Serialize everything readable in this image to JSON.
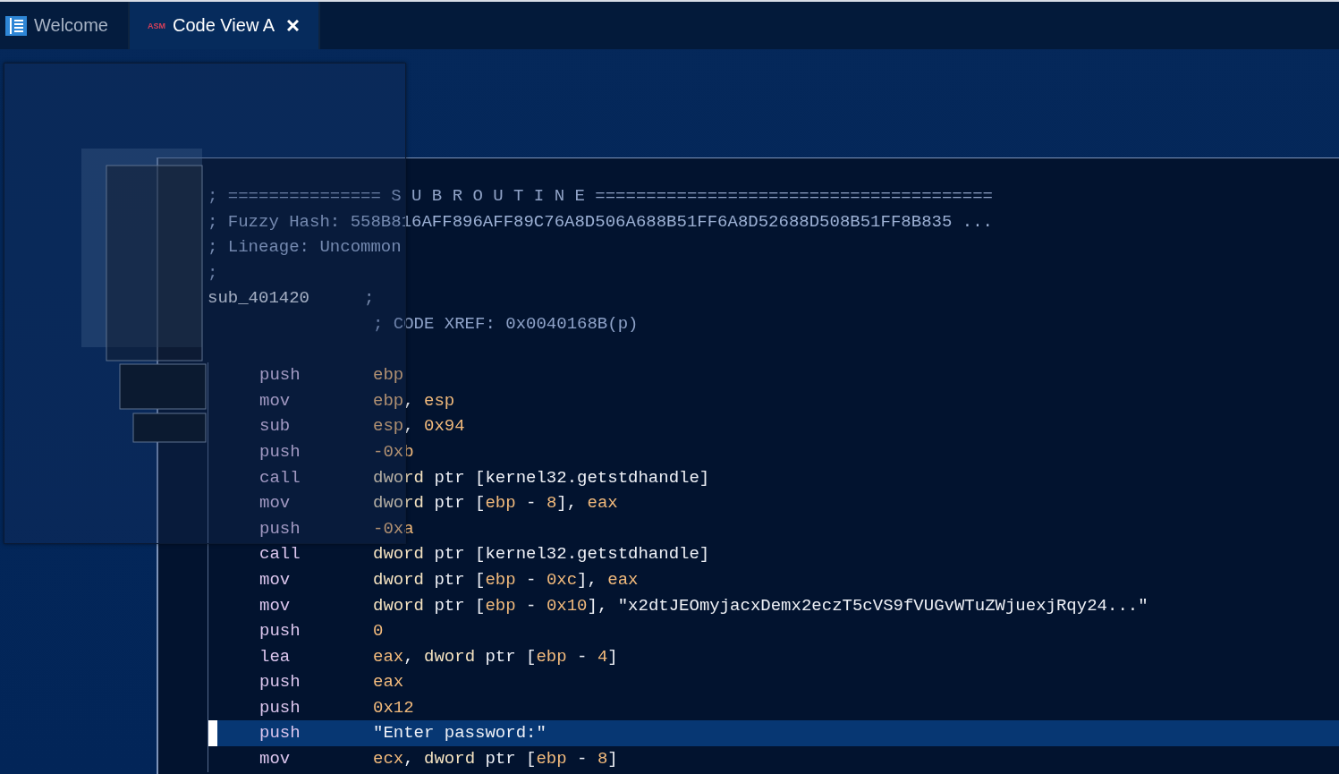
{
  "tabs": [
    {
      "label": "Welcome",
      "selected": false,
      "closable": false
    },
    {
      "label": "Code View A",
      "badge": "ASM",
      "selected": true,
      "closable": true
    }
  ],
  "block": {
    "header_lines": [
      "; =============== S U B R O U T I N E =======================================",
      "; Fuzzy Hash: 558B816AFF896AFF89C76A8D506A688B51FF6A8D52688D508B51FF8B835 ...",
      "; Lineage: Uncommon",
      ";"
    ],
    "label": {
      "name": "sub_401420",
      "comment": ";"
    },
    "xref": "; CODE XREF: 0x0040168B(p)",
    "instructions": [
      {
        "mnemonic": "push",
        "selected": false,
        "operands": [
          {
            "text": "ebp",
            "kind": "reg"
          }
        ]
      },
      {
        "mnemonic": "mov",
        "selected": false,
        "operands": [
          {
            "text": "ebp",
            "kind": "reg"
          },
          {
            "text": ", ",
            "kind": "plain"
          },
          {
            "text": "esp",
            "kind": "reg"
          }
        ]
      },
      {
        "mnemonic": "sub",
        "selected": false,
        "operands": [
          {
            "text": "esp",
            "kind": "reg"
          },
          {
            "text": ", ",
            "kind": "plain"
          },
          {
            "text": "0x94",
            "kind": "reg"
          }
        ]
      },
      {
        "mnemonic": "push",
        "selected": false,
        "operands": [
          {
            "text": "-0xb",
            "kind": "reg"
          }
        ]
      },
      {
        "mnemonic": "call",
        "selected": false,
        "operands": [
          {
            "text": "dword",
            "kind": "kw"
          },
          {
            "text": " ptr [kernel32.getstdhandle]",
            "kind": "plain"
          }
        ]
      },
      {
        "mnemonic": "mov",
        "selected": false,
        "operands": [
          {
            "text": "dword",
            "kind": "kw"
          },
          {
            "text": " ptr [",
            "kind": "plain"
          },
          {
            "text": "ebp",
            "kind": "reg"
          },
          {
            "text": " - ",
            "kind": "plain"
          },
          {
            "text": "8",
            "kind": "reg"
          },
          {
            "text": "], ",
            "kind": "plain"
          },
          {
            "text": "eax",
            "kind": "reg"
          }
        ]
      },
      {
        "mnemonic": "push",
        "selected": false,
        "operands": [
          {
            "text": "-0xa",
            "kind": "reg"
          }
        ]
      },
      {
        "mnemonic": "call",
        "selected": false,
        "operands": [
          {
            "text": "dword",
            "kind": "kw"
          },
          {
            "text": " ptr [kernel32.getstdhandle]",
            "kind": "plain"
          }
        ]
      },
      {
        "mnemonic": "mov",
        "selected": false,
        "operands": [
          {
            "text": "dword",
            "kind": "kw"
          },
          {
            "text": " ptr [",
            "kind": "plain"
          },
          {
            "text": "ebp",
            "kind": "reg"
          },
          {
            "text": " - ",
            "kind": "plain"
          },
          {
            "text": "0xc",
            "kind": "reg"
          },
          {
            "text": "], ",
            "kind": "plain"
          },
          {
            "text": "eax",
            "kind": "reg"
          }
        ]
      },
      {
        "mnemonic": "mov",
        "selected": false,
        "operands": [
          {
            "text": "dword",
            "kind": "kw"
          },
          {
            "text": " ptr [",
            "kind": "plain"
          },
          {
            "text": "ebp",
            "kind": "reg"
          },
          {
            "text": " - ",
            "kind": "plain"
          },
          {
            "text": "0x10",
            "kind": "reg"
          },
          {
            "text": "], \"x2dtJEOmyjacxDemx2eczT5cVS9fVUGvWTuZWjuexjRqy24...\"",
            "kind": "plain"
          }
        ]
      },
      {
        "mnemonic": "push",
        "selected": false,
        "operands": [
          {
            "text": "0",
            "kind": "reg"
          }
        ]
      },
      {
        "mnemonic": "lea",
        "selected": false,
        "operands": [
          {
            "text": "eax",
            "kind": "reg"
          },
          {
            "text": ", ",
            "kind": "plain"
          },
          {
            "text": "dword",
            "kind": "kw"
          },
          {
            "text": " ptr [",
            "kind": "plain"
          },
          {
            "text": "ebp",
            "kind": "reg"
          },
          {
            "text": " - ",
            "kind": "plain"
          },
          {
            "text": "4",
            "kind": "reg"
          },
          {
            "text": "]",
            "kind": "plain"
          }
        ]
      },
      {
        "mnemonic": "push",
        "selected": false,
        "operands": [
          {
            "text": "eax",
            "kind": "reg"
          }
        ]
      },
      {
        "mnemonic": "push",
        "selected": false,
        "operands": [
          {
            "text": "0x12",
            "kind": "reg"
          }
        ]
      },
      {
        "mnemonic": "push",
        "selected": true,
        "operands": [
          {
            "text": "\"Enter password:\"",
            "kind": "plain"
          }
        ]
      },
      {
        "mnemonic": "mov",
        "selected": false,
        "operands": [
          {
            "text": "ecx",
            "kind": "reg"
          },
          {
            "text": ", ",
            "kind": "plain"
          },
          {
            "text": "dword",
            "kind": "kw"
          },
          {
            "text": " ptr [",
            "kind": "plain"
          },
          {
            "text": "ebp",
            "kind": "reg"
          },
          {
            "text": " - ",
            "kind": "plain"
          },
          {
            "text": "8",
            "kind": "reg"
          },
          {
            "text": "]",
            "kind": "plain"
          }
        ]
      }
    ]
  }
}
